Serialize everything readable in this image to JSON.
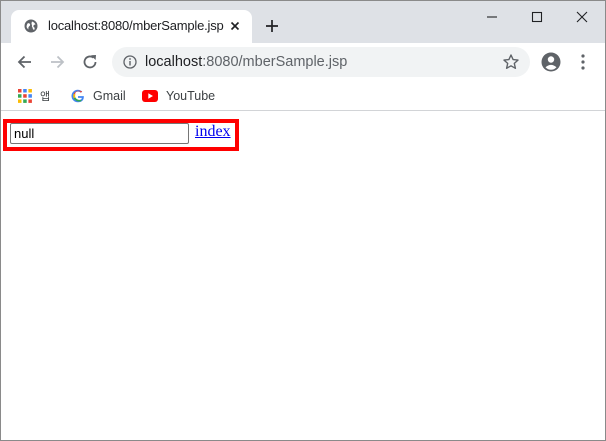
{
  "browser": {
    "tab": {
      "title": "localhost:8080/mberSample.jsp",
      "favicon": "globe-icon"
    },
    "window_controls": [
      "minimize-icon",
      "maximize-icon",
      "close-icon"
    ],
    "toolbar": {
      "url_host": "localhost",
      "url_rest": ":8080/mberSample.jsp"
    },
    "bookmarks": [
      {
        "label": "앱",
        "icon": "apps-grid-icon"
      },
      {
        "label": "Gmail",
        "icon": "google-icon"
      },
      {
        "label": "YouTube",
        "icon": "youtube-icon"
      }
    ]
  },
  "page": {
    "input_value": "null",
    "link_label": "index"
  },
  "colors": {
    "highlight": "#ff0000",
    "link": "#0000ee",
    "tabstrip": "#dee1e6"
  }
}
